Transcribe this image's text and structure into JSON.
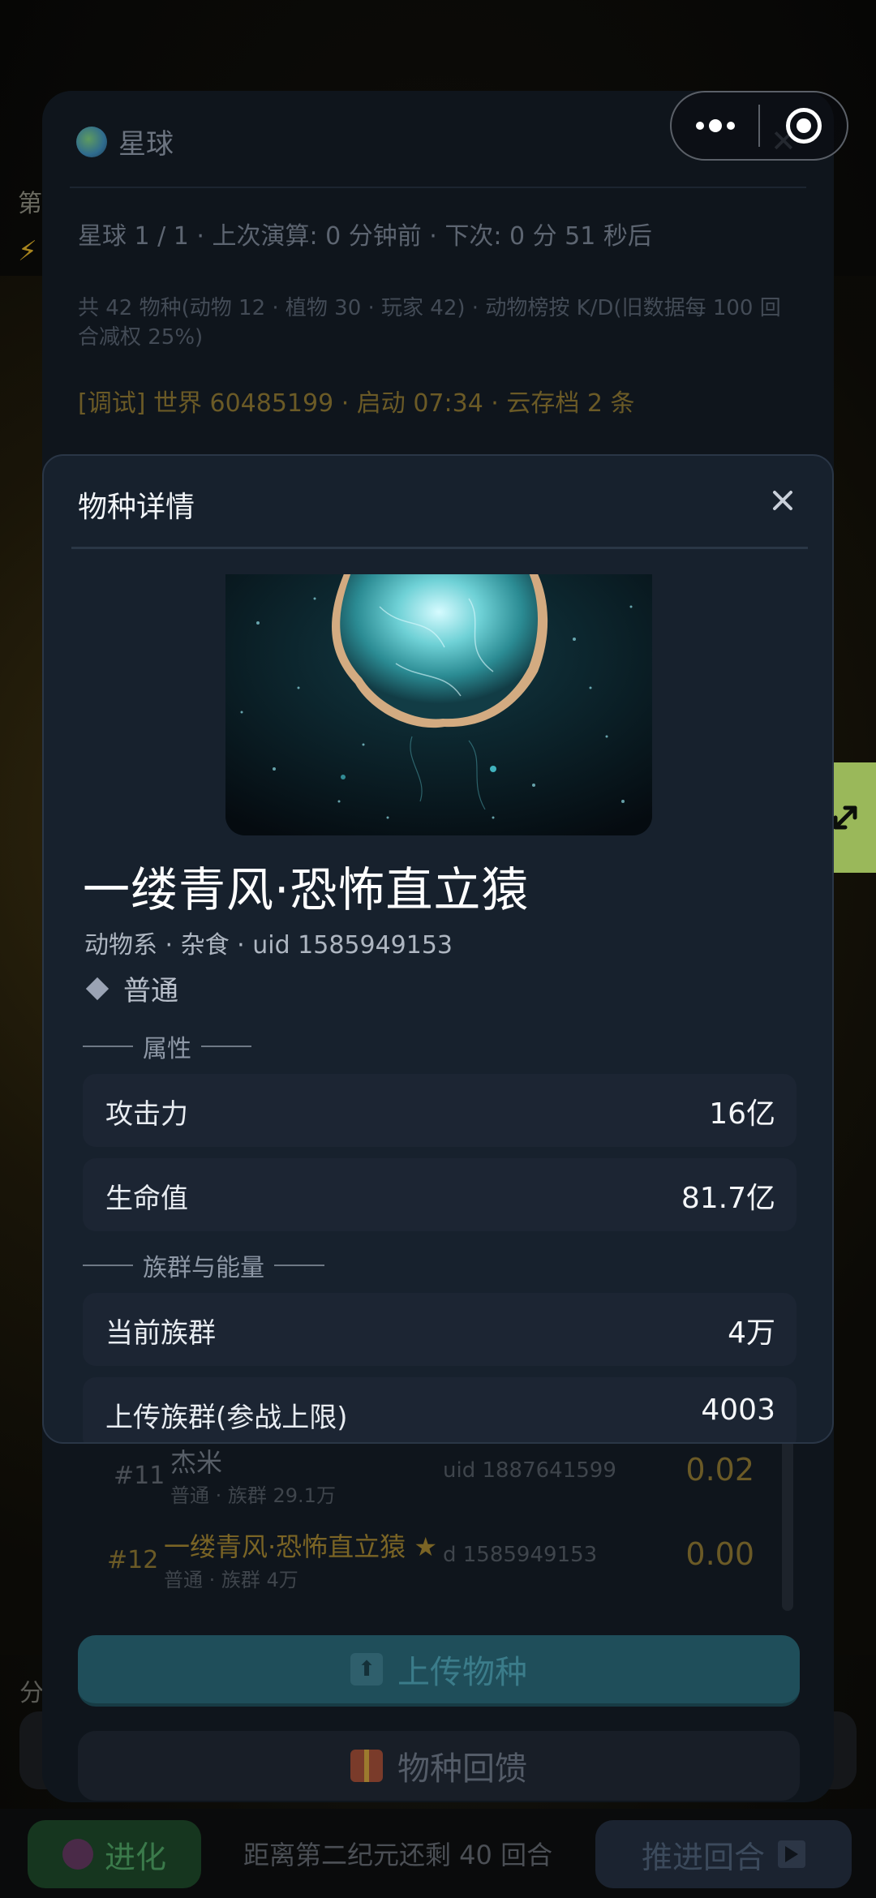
{
  "background": {
    "left_text": "第",
    "evolve_label": "进化",
    "remaining_text": "距离第二纪元还剩 40 回合",
    "advance_label": "推进回合",
    "share_text": "分"
  },
  "planet_panel": {
    "title": "星球",
    "status": "星球 1 / 1 · 上次演算: 0 分钟前 · 下次: 0 分 51 秒后",
    "species_summary": "共 42 物种(动物 12 · 植物 30 · 玩家 42) · 动物榜按 K/D(旧数据每 100 回合减权 25%)",
    "debug_line": "[调试] 世界 60485199 · 启动 07:34 · 云存档 2 条",
    "rank_rows": [
      {
        "rank": "#11",
        "name": "杰米",
        "sub": "普通 · 族群 29.1万",
        "uid": "uid 1887641599",
        "score": "0.02"
      },
      {
        "rank": "#12",
        "name": "一缕青风·恐怖直立猿",
        "star": "★",
        "sub": "普通 · 族群 4万",
        "uid": "d 1585949153",
        "score": "0.00"
      }
    ],
    "upload_label": "上传物种",
    "feedback_label": "物种回馈"
  },
  "modal": {
    "title": "物种详情",
    "species_name": "一缕青风·恐怖直立猿",
    "meta": "动物系 · 杂食 · uid 1585949153",
    "rarity": "普通",
    "sections": {
      "attributes": "属性",
      "population": "族群与能量"
    },
    "attributes": [
      {
        "label": "攻击力",
        "value": "16亿"
      },
      {
        "label": "生命值",
        "value": "81.7亿"
      }
    ],
    "population": [
      {
        "label": "当前族群",
        "value": "4万"
      },
      {
        "label": "上传族群(参战上限)",
        "value": "4003"
      }
    ]
  },
  "colors": {
    "modal_bg": "#17212d",
    "accent_gold": "#6b5a26",
    "expand_green": "#9ab85a",
    "upload_teal": "#1f4e5a"
  },
  "icons": [
    "globe-icon",
    "close-icon",
    "more-dots-icon",
    "capsule-close-icon",
    "expand-icon",
    "upload-icon",
    "gift-icon",
    "diamond-icon",
    "chevron-right-icon",
    "star-icon",
    "bolt-icon",
    "play-icon"
  ]
}
